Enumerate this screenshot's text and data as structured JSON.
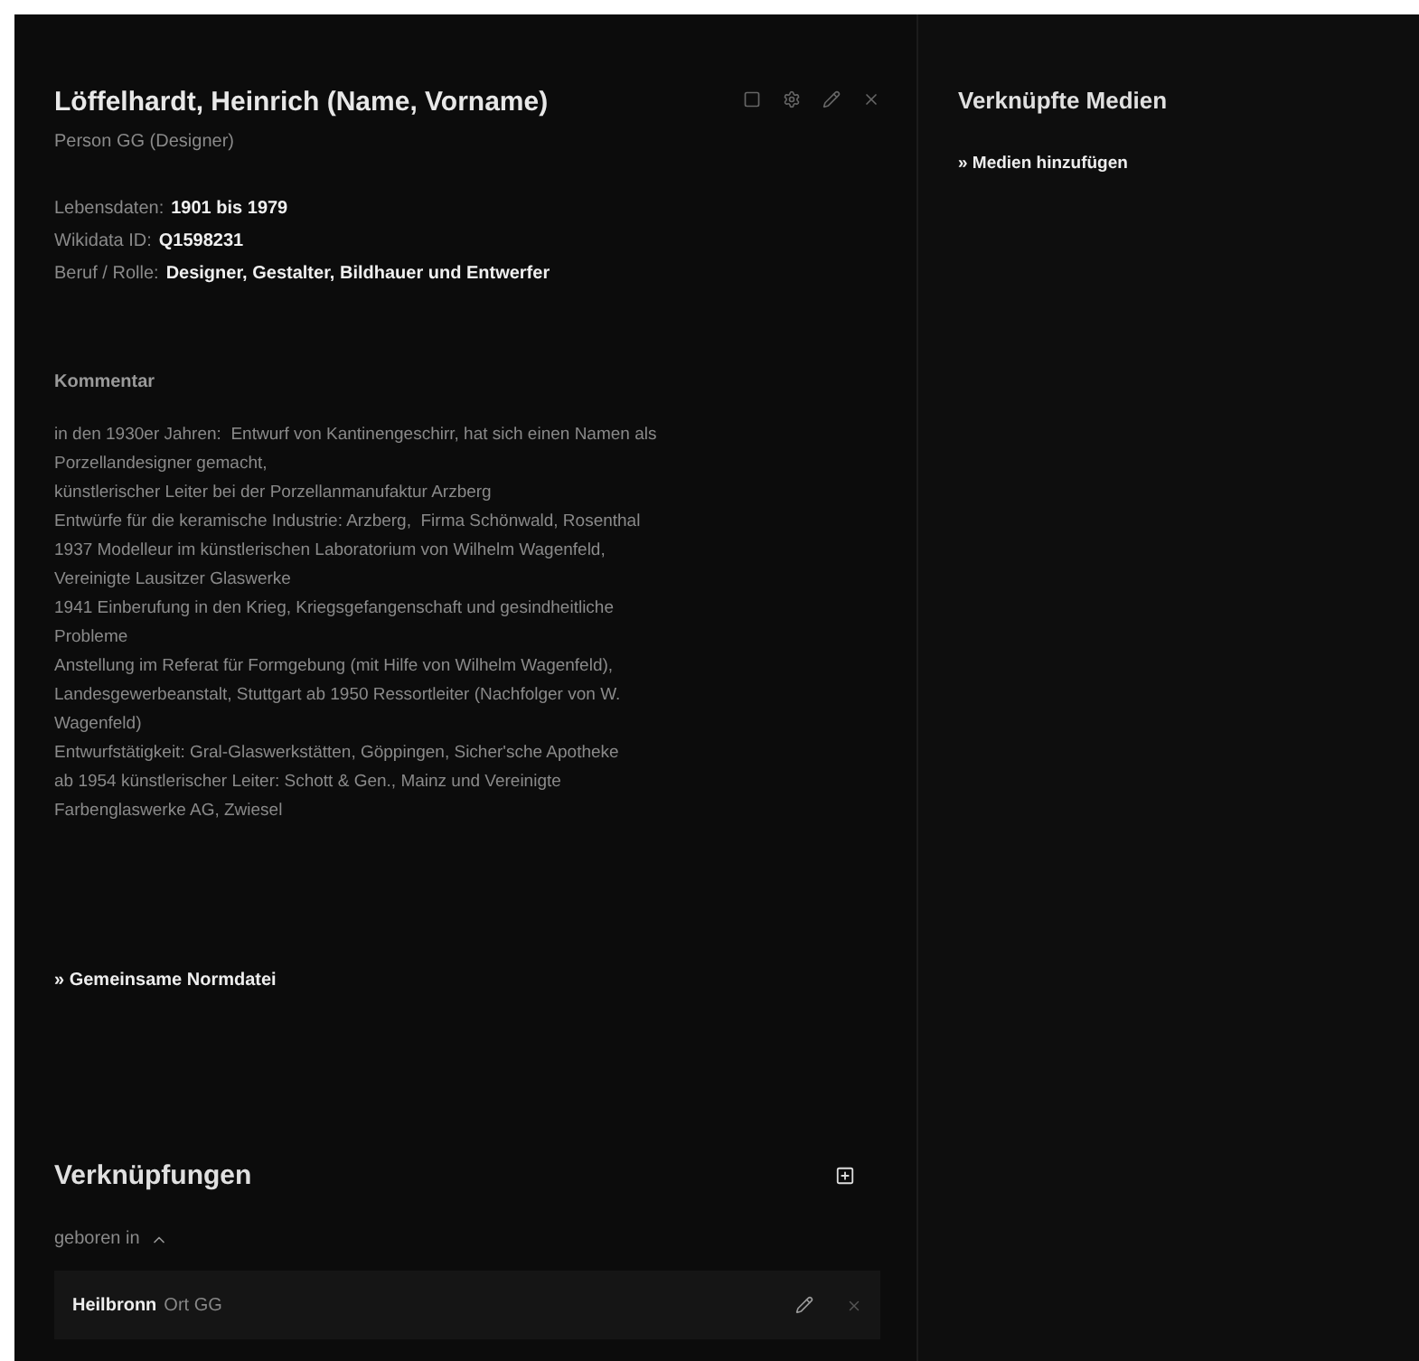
{
  "record": {
    "title": "Löffelhardt, Heinrich (Name, Vorname)",
    "subtitle": "Person GG (Designer)",
    "facts": [
      {
        "label": "Lebensdaten:",
        "value": "1901 bis 1979"
      },
      {
        "label": "Wikidata ID:",
        "value": "Q1598231"
      },
      {
        "label": "Beruf / Rolle:",
        "value": "Designer, Gestalter, Bildhauer und Entwerfer"
      }
    ],
    "comment_heading": "Kommentar",
    "comment_lines": [
      "in den 1930er Jahren:  Entwurf von Kantinengeschirr, hat sich einen Namen als",
      "Porzellandesigner gemacht,",
      "künstlerischer Leiter bei der Porzellanmanufaktur Arzberg",
      "Entwürfe für die keramische Industrie: Arzberg,  Firma Schönwald, Rosenthal",
      "1937 Modelleur im künstlerischen Laboratorium von Wilhelm Wagenfeld,",
      "Vereinigte Lausitzer Glaswerke",
      "1941 Einberufung in den Krieg, Kriegsgefangenschaft und gesindheitliche",
      "Probleme",
      "Anstellung im Referat für Formgebung (mit Hilfe von Wilhelm Wagenfeld),",
      "Landesgewerbeanstalt, Stuttgart ab 1950 Ressortleiter (Nachfolger von W.",
      "Wagenfeld)",
      "Entwurfstätigkeit: Gral-Glaswerkstätten, Göppingen, Sicher'sche Apotheke",
      "ab 1954 künstlerischer Leiter: Schott & Gen., Mainz und Vereinigte",
      "Farbenglaswerke AG, Zwiesel"
    ],
    "normdatei_link": "» Gemeinsame Normdatei"
  },
  "links": {
    "title": "Verknüpfungen",
    "groups": [
      {
        "label": "geboren in",
        "expanded": true,
        "items": [
          {
            "name": "Heilbronn",
            "type": "Ort GG"
          }
        ]
      }
    ]
  },
  "media": {
    "title": "Verknüpfte Medien",
    "add_link": "» Medien hinzufügen"
  }
}
